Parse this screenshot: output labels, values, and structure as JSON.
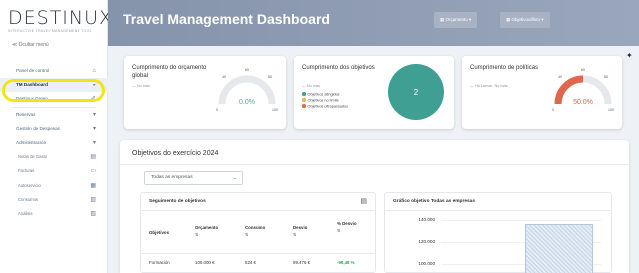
{
  "app": {
    "logo": "DESTINUX",
    "tagline": "INTERACTIVE TRAVEL MANAGEMENT TOOL",
    "hide_menu": "Ocultar menú"
  },
  "sidebar": {
    "items": [
      {
        "label": "Panel de control",
        "icon": "home-icon",
        "glyph": "⌂"
      },
      {
        "label": "TM Dashboard",
        "icon": "dashboard-icon",
        "glyph": "◒",
        "active": true
      },
      {
        "label": "Destinux Green",
        "icon": "leaf-icon",
        "glyph": "✐"
      },
      {
        "label": "Reservas",
        "icon": "chevron-down-icon",
        "glyph": "▾"
      },
      {
        "label": "Gestión de Despesas",
        "icon": "chevron-down-icon",
        "glyph": "▾"
      },
      {
        "label": "Administración",
        "icon": "chevron-down-icon",
        "glyph": "▾"
      }
    ],
    "sub_items": [
      {
        "label": "Notas de Gasto",
        "icon": "document-icon",
        "glyph": "▤"
      },
      {
        "label": "Facturas",
        "icon": "invoice-icon",
        "glyph": "▭"
      },
      {
        "label": "Autoservicio",
        "icon": "grid-icon",
        "glyph": "▦"
      },
      {
        "label": "Consumos",
        "icon": "chart-bars-icon",
        "glyph": "▥"
      },
      {
        "label": "Análisis",
        "icon": "analysis-icon",
        "glyph": "▥"
      }
    ]
  },
  "header": {
    "title": "Travel Management Dashboard",
    "budget_dropdown": "▦ Orçamento ▾",
    "objectives_dropdown": "▦ Objetivos/libro ▾"
  },
  "cards": {
    "budget": {
      "title": "Cumprimento do orçamento global",
      "subtitle": "— No más",
      "value": "0.0%",
      "value_pct": 0,
      "ticks": [
        "0",
        "40",
        "60",
        "80",
        "100"
      ],
      "color": "#4aa9a4"
    },
    "objectives": {
      "title": "Cumprimento dos objetivos",
      "subtitle": "— No más",
      "value": "2",
      "legend": [
        {
          "label": "Objetivos atingidos",
          "color": "#3f9f93"
        },
        {
          "label": "Objetivos no límite",
          "color": "#e8b945"
        },
        {
          "label": "Objetivos ultrapassados",
          "color": "#e2664e"
        }
      ],
      "color": "#3f9f93"
    },
    "policies": {
      "title": "Cumprimento de políticas",
      "subtitle": "— Há Larnac. No más",
      "value": "50.0%",
      "value_pct": 50,
      "ticks": [
        "0",
        "40",
        "60",
        "80",
        "100"
      ],
      "color": "#e2664e"
    }
  },
  "objectives_panel": {
    "title": "Objetivos do exercício 2024",
    "company_select": "Todas as empresas",
    "tracking": {
      "title": "Seguimento de objetivos",
      "columns": [
        "Objetivos",
        "Orçamento",
        "Consumo",
        "Desvio",
        "% Desvio"
      ],
      "rows": [
        [
          "Formación",
          "100.000 €",
          "524 €",
          "99.476 €",
          "-99,48 %"
        ]
      ]
    },
    "chart": {
      "title": "Gráfico objetivo Todas as empresas",
      "y_ticks": [
        "140.000",
        "120.000",
        "100.000"
      ]
    }
  },
  "chart_data": {
    "type": "bar",
    "title": "Gráfico objetivo Todas as empresas",
    "categories": [
      ""
    ],
    "values": [
      100000
    ],
    "ylim": [
      100000,
      140000
    ]
  },
  "colors": {
    "header": "#8593ab",
    "accent": "#4aa9a4",
    "active_item_bg": "#e9f0f7",
    "highlight": "#f4e31a",
    "gauge_track": "#e6e8eb"
  }
}
